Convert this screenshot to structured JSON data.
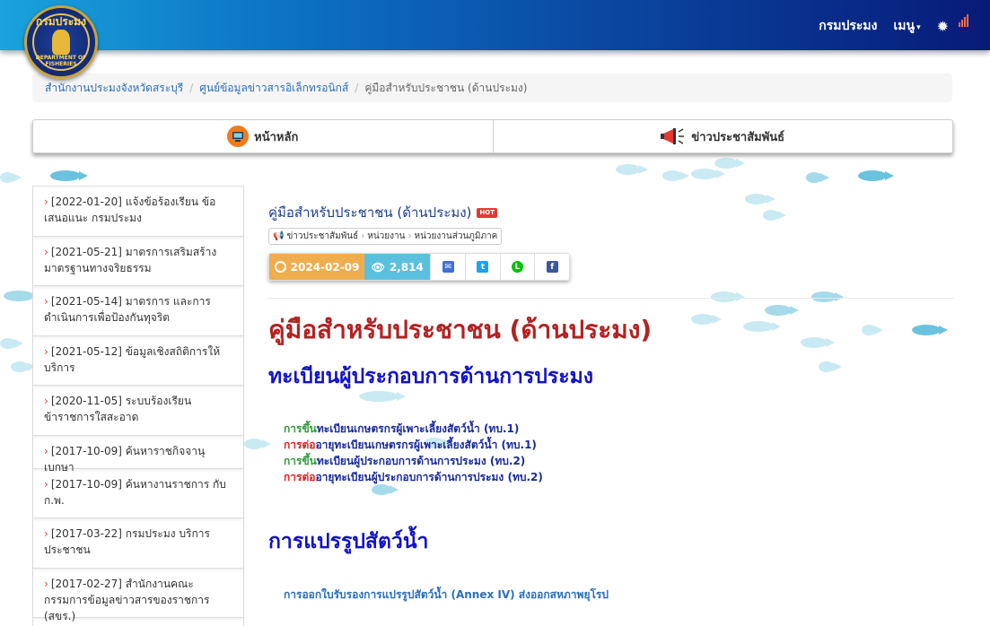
{
  "header": {
    "logo_text_top": "กรมประมง",
    "logo_text_bottom": "DEPARTMENT OF FISHERIES",
    "nav": [
      {
        "label": "กรมประมง"
      },
      {
        "label": "เมนู"
      }
    ]
  },
  "breadcrumb": {
    "items": [
      {
        "label": "สำนักงานประมงจังหวัดสระบุรี"
      },
      {
        "label": "ศูนย์ข้อมูลข่าวสารอิเล็กทรอนิกส์"
      },
      {
        "label": "คู่มือสำหรับประชาชน (ด้านประมง)"
      }
    ]
  },
  "tabs": [
    {
      "label": "หน้าหลัก"
    },
    {
      "label": "ข่าวประชาสัมพันธ์"
    }
  ],
  "sidebar": {
    "items": [
      {
        "label": "[2022-01-20] แจ้งข้อร้องเรียน ข้อเสนอแนะ กรมประมง"
      },
      {
        "label": "[2021-05-21] มาตรการเสริมสร้างมาตรฐานทางจริยธรรม"
      },
      {
        "label": "[2021-05-14] มาตรการ และการดำเนินการเพื่อป้องกันทุจริต"
      },
      {
        "label": "[2021-05-12] ข้อมูลเชิงสถิติการให้บริการ"
      },
      {
        "label": "[2020-11-05] ระบบร้องเรียนข้าราชการใสสะอาด"
      },
      {
        "label": "[2017-10-09] ค้นหาราชกิจจานุเบกษา"
      },
      {
        "label": "[2017-10-09] ค้นหางานราชการ กับ ก.พ."
      },
      {
        "label": "[2017-03-22] กรมประมง บริการประชาชน"
      },
      {
        "label": "[2017-02-27] สำนักงานคณะกรรมการข้อมูลข่าวสารของราชการ (สขร.)"
      }
    ]
  },
  "article": {
    "title": "คู่มือสำหรับประชาชน (ด้านประมง)",
    "hot_badge": "HOT",
    "tags": [
      "ข่าวประชาสัมพันธ์",
      "หน่วยงาน",
      "หน่วยงานส่วนภูมิภาค"
    ],
    "date": "2024-02-09",
    "views": "2,814",
    "heading": "คู่มือสำหรับประชาชน (ด้านประมง)",
    "section1": {
      "title": "ทะเบียนผู้ประกอบการด้านการประมง",
      "links": [
        {
          "prefix": "การขึ้น",
          "rest": "ทะเบียนเกษตรกรผู้เพาะเลี้ยงสัตว์น้ำ (ทบ.1)"
        },
        {
          "prefix": "การต่อ",
          "rest": "อายุทะเบียนเกษตรกรผู้เพาะเลี้ยงสัตว์น้ำ (ทบ.1)"
        },
        {
          "prefix": "การขึ้น",
          "rest": "ทะเบียนผู้ประกอบการด้านการประมง (ทบ.2)"
        },
        {
          "prefix": "การต่อ",
          "rest": "อายุทะเบียนผู้ประกอบการด้านการประมง (ทบ.2)"
        }
      ]
    },
    "section2": {
      "title": "การแปรรูปสัตว์น้ำ",
      "link": "การออกใบรับรองการแปรรูปสัตว์น้ำ (Annex IV) ส่งออกสหภาพยุโรป"
    }
  },
  "colors": {
    "header_start": "#1aa3dc",
    "header_end": "#081a78",
    "heading_red": "#b22222",
    "section_blue": "#1212c8",
    "date_badge": "#f0ad4e",
    "views_badge": "#5bc0de"
  }
}
